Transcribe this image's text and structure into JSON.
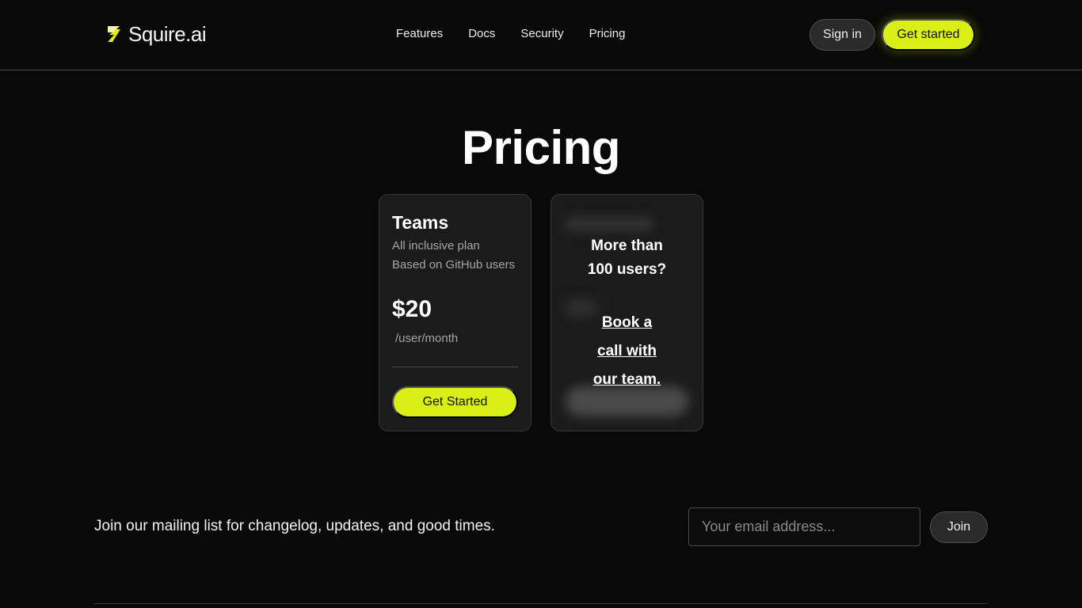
{
  "header": {
    "brand": "Squire.ai",
    "logo_icon": "lightning-bolt-icon",
    "nav": [
      "Features",
      "Docs",
      "Security",
      "Pricing"
    ],
    "sign_in": "Sign in",
    "get_started": "Get started"
  },
  "main": {
    "title": "Pricing",
    "teams_card": {
      "name": "Teams",
      "desc_line1": "All inclusive plan",
      "desc_line2": "Based on GitHub users",
      "price": "$20",
      "unit": "/user/month",
      "cta": "Get Started"
    },
    "enterprise_card": {
      "question_line1": "More than",
      "question_line2": "100 users?",
      "link_line1": "Book a",
      "link_line2": "call with",
      "link_line3": "our team."
    }
  },
  "mailing": {
    "text": "Join our mailing list for changelog, updates, and good times.",
    "email_placeholder": "Your email address...",
    "join": "Join"
  },
  "colors": {
    "background": "#080908",
    "accent": "#d9ef16",
    "card": "#1b1b1b"
  }
}
